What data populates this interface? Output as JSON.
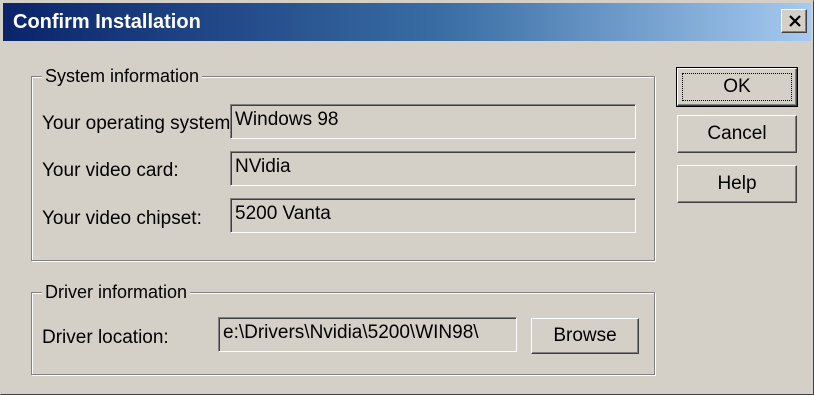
{
  "window": {
    "title": "Confirm Installation"
  },
  "system_group": {
    "legend": "System information",
    "rows": [
      {
        "label": "Your operating system:",
        "value": "Windows 98"
      },
      {
        "label": "Your video card:",
        "value": "NVidia"
      },
      {
        "label": "Your video chipset:",
        "value": "5200 Vanta"
      }
    ]
  },
  "driver_group": {
    "legend": "Driver information",
    "location_label": "Driver location:",
    "location_value": "e:\\Drivers\\Nvidia\\5200\\WIN98\\",
    "browse_label": "Browse"
  },
  "buttons": {
    "ok": "OK",
    "cancel": "Cancel",
    "help": "Help"
  },
  "colors": {
    "face": "#d4d0c8",
    "title_start": "#0a246a",
    "title_end": "#a6caf0"
  },
  "icons": {
    "close": "close-icon"
  }
}
